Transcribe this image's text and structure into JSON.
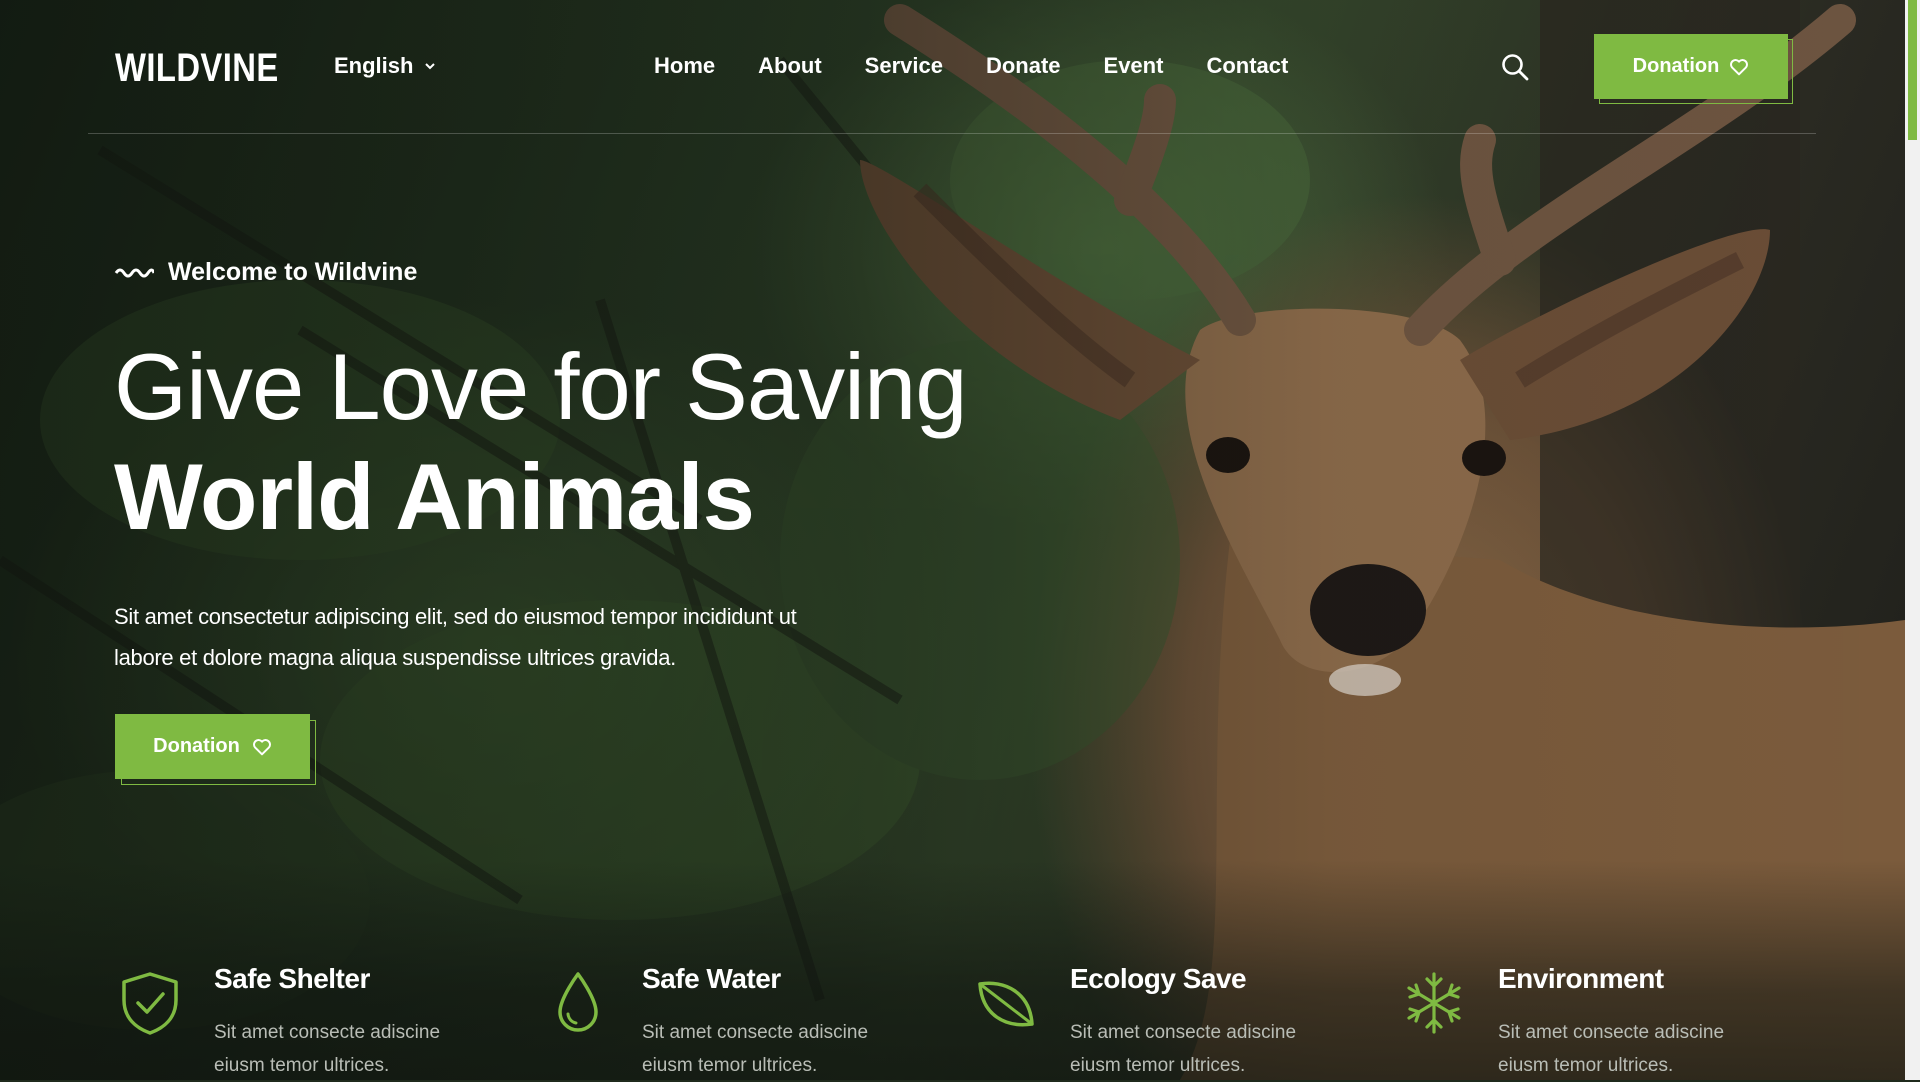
{
  "brand": {
    "logo": "WILDVINE",
    "accent": "#7fba42"
  },
  "header": {
    "language": "English",
    "nav": [
      "Home",
      "About",
      "Service",
      "Donate",
      "Event",
      "Contact"
    ],
    "donate_label": "Donation"
  },
  "hero": {
    "welcome": "Welcome to Wildvine",
    "title_line1": "Give Love for Saving",
    "title_line2": "World Animals",
    "desc_line1": "Sit amet consectetur adipiscing elit, sed do eiusmod tempor incididunt ut",
    "desc_line2": "labore et dolore magna aliqua suspendisse ultrices gravida.",
    "donate_label": "Donation"
  },
  "features": [
    {
      "icon": "shield-check-icon",
      "title": "Safe Shelter",
      "desc_line1": "Sit amet consecte adiscine",
      "desc_line2": "eiusm temor ultrices."
    },
    {
      "icon": "water-drop-icon",
      "title": "Safe Water",
      "desc_line1": "Sit amet consecte adiscine",
      "desc_line2": "eiusm temor ultrices."
    },
    {
      "icon": "leaf-icon",
      "title": "Ecology Save",
      "desc_line1": "Sit amet consecte adiscine",
      "desc_line2": "eiusm temor ultrices."
    },
    {
      "icon": "snowflake-icon",
      "title": "Environment",
      "desc_line1": "Sit amet consecte adiscine",
      "desc_line2": "eiusm temor ultrices."
    }
  ]
}
